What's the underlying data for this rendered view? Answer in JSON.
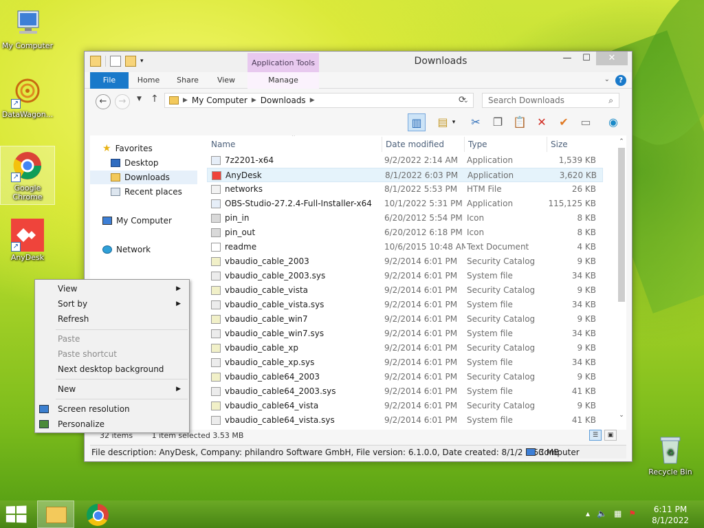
{
  "desktop": {
    "icons": [
      {
        "label": "My Computer"
      },
      {
        "label": "DataWagon..."
      },
      {
        "label": "Google Chrome"
      },
      {
        "label": "AnyDesk"
      },
      {
        "label": "Recycle Bin"
      }
    ]
  },
  "window": {
    "title": "Downloads",
    "contextual_tab_group": "Application Tools",
    "tabs": {
      "file": "File",
      "home": "Home",
      "share": "Share",
      "view": "View",
      "manage": "Manage"
    },
    "address": {
      "crumbs": [
        "My Computer",
        "Downloads"
      ]
    },
    "search": {
      "placeholder": "Search Downloads"
    }
  },
  "navpane": {
    "favorites": "Favorites",
    "desktop": "Desktop",
    "downloads": "Downloads",
    "recent": "Recent places",
    "computer": "My Computer",
    "network": "Network"
  },
  "columns": {
    "name": "Name",
    "date": "Date modified",
    "type": "Type",
    "size": "Size"
  },
  "files": [
    {
      "name": "7z2201-x64",
      "date": "9/2/2022 2:14 AM",
      "type": "Application",
      "size": "1,539 KB"
    },
    {
      "name": "AnyDesk",
      "date": "8/1/2022 6:03 PM",
      "type": "Application",
      "size": "3,620 KB",
      "selected": true
    },
    {
      "name": "networks",
      "date": "8/1/2022 5:53 PM",
      "type": "HTM File",
      "size": "26 KB"
    },
    {
      "name": "OBS-Studio-27.2.4-Full-Installer-x64",
      "date": "10/1/2022 5:31 PM",
      "type": "Application",
      "size": "115,125 KB"
    },
    {
      "name": "pin_in",
      "date": "6/20/2012 5:54 PM",
      "type": "Icon",
      "size": "8 KB"
    },
    {
      "name": "pin_out",
      "date": "6/20/2012 6:18 PM",
      "type": "Icon",
      "size": "8 KB"
    },
    {
      "name": "readme",
      "date": "10/6/2015 10:48 AM",
      "type": "Text Document",
      "size": "4 KB"
    },
    {
      "name": "vbaudio_cable_2003",
      "date": "9/2/2014 6:01 PM",
      "type": "Security Catalog",
      "size": "9 KB"
    },
    {
      "name": "vbaudio_cable_2003.sys",
      "date": "9/2/2014 6:01 PM",
      "type": "System file",
      "size": "34 KB"
    },
    {
      "name": "vbaudio_cable_vista",
      "date": "9/2/2014 6:01 PM",
      "type": "Security Catalog",
      "size": "9 KB"
    },
    {
      "name": "vbaudio_cable_vista.sys",
      "date": "9/2/2014 6:01 PM",
      "type": "System file",
      "size": "34 KB"
    },
    {
      "name": "vbaudio_cable_win7",
      "date": "9/2/2014 6:01 PM",
      "type": "Security Catalog",
      "size": "9 KB"
    },
    {
      "name": "vbaudio_cable_win7.sys",
      "date": "9/2/2014 6:01 PM",
      "type": "System file",
      "size": "34 KB"
    },
    {
      "name": "vbaudio_cable_xp",
      "date": "9/2/2014 6:01 PM",
      "type": "Security Catalog",
      "size": "9 KB"
    },
    {
      "name": "vbaudio_cable_xp.sys",
      "date": "9/2/2014 6:01 PM",
      "type": "System file",
      "size": "34 KB"
    },
    {
      "name": "vbaudio_cable64_2003",
      "date": "9/2/2014 6:01 PM",
      "type": "Security Catalog",
      "size": "9 KB"
    },
    {
      "name": "vbaudio_cable64_2003.sys",
      "date": "9/2/2014 6:01 PM",
      "type": "System file",
      "size": "41 KB"
    },
    {
      "name": "vbaudio_cable64_vista",
      "date": "9/2/2014 6:01 PM",
      "type": "Security Catalog",
      "size": "9 KB"
    },
    {
      "name": "vbaudio_cable64_vista.sys",
      "date": "9/2/2014 6:01 PM",
      "type": "System file",
      "size": "41 KB"
    }
  ],
  "status": {
    "count": "32 items",
    "selected": "1 item selected  3.53 MB"
  },
  "details": {
    "description": "File description: AnyDesk, Company: philandro Software GmbH, File version: 6.1.0.0, Date created: 8/1/2 3.53 MB",
    "location": "Computer"
  },
  "context_menu": {
    "view": "View",
    "sort_by": "Sort by",
    "refresh": "Refresh",
    "paste": "Paste",
    "paste_shortcut": "Paste shortcut",
    "next_background": "Next desktop background",
    "new": "New",
    "screen_resolution": "Screen resolution",
    "personalize": "Personalize"
  },
  "taskbar": {
    "time": "6:11 PM",
    "date": "8/1/2022"
  },
  "colors": {
    "ribbon_file": "#1979ca",
    "contextual_tab": "#e8c9ef",
    "selection": "#e5f3fb"
  }
}
